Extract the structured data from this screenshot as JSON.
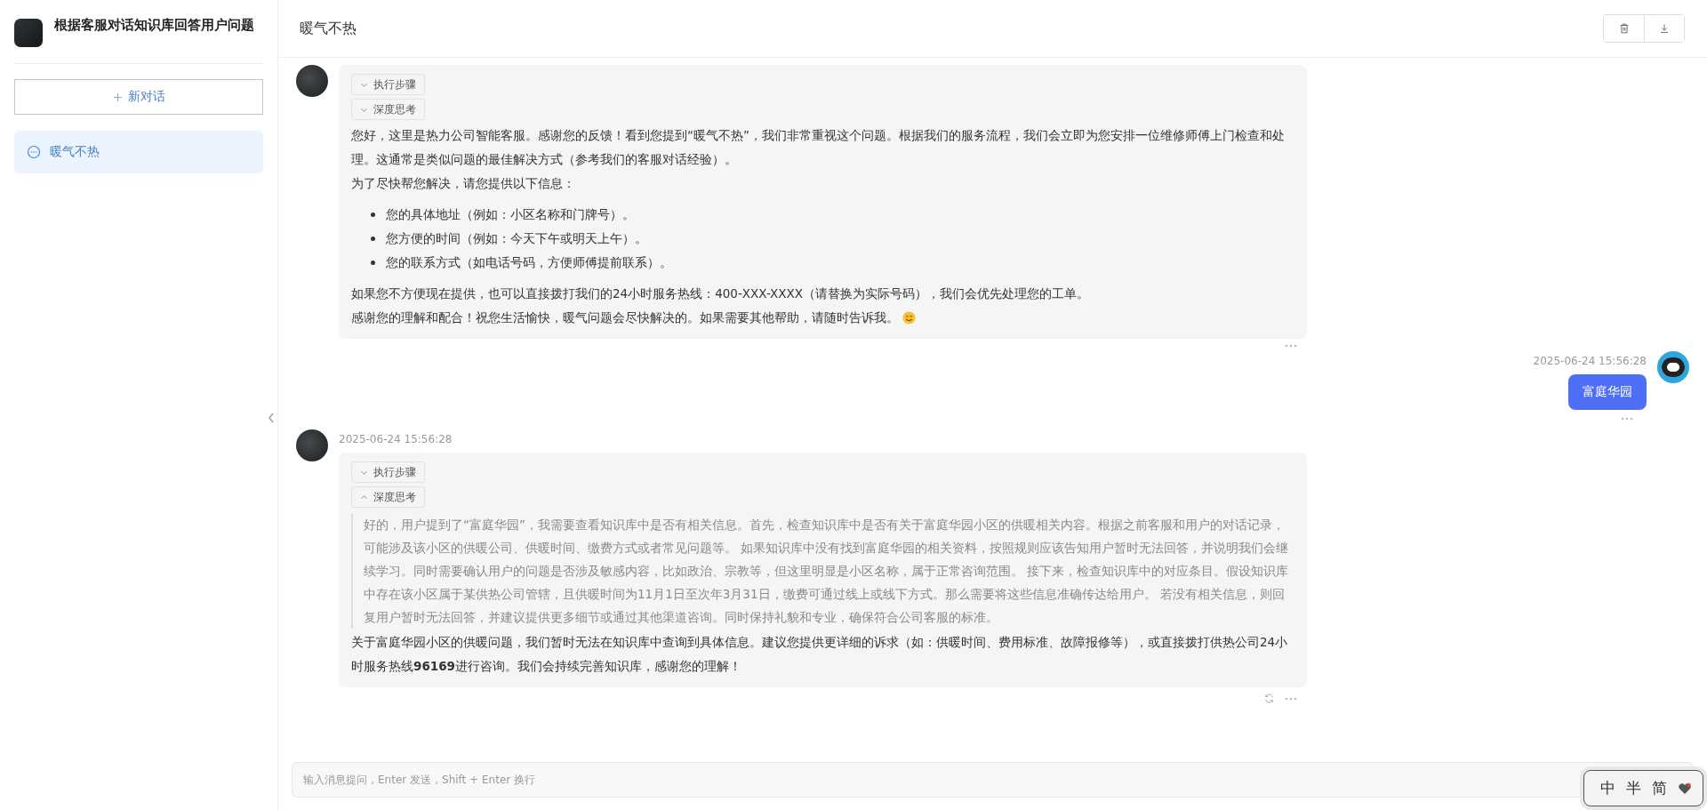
{
  "app": {
    "title": "根据客服对话知识库回答用户问题"
  },
  "new_chat_button": {
    "label": "新对话"
  },
  "conversations": [
    {
      "title": "暖气不热",
      "selected": true
    }
  ],
  "chat": {
    "title": "暖气不热"
  },
  "messages": [
    {
      "kind": "assistant",
      "steps": [
        {
          "label": "执行步骤",
          "expanded": false
        },
        {
          "label": "深度思考",
          "expanded": false
        }
      ],
      "blocks": [
        {
          "kind": "text",
          "lines": [
            "您好，这里是热力公司智能客服。感谢您的反馈！看到您提到“暖气不热”，我们非常重视这个问题。根据我们的服务流程，我们会立即为您安排一位维修师傅上门检查和处理。这通常是类似问题的最佳解决方式（参考我们的客服对话经验）。",
            "为了尽快帮您解决，请您提供以下信息："
          ]
        },
        {
          "kind": "list",
          "items": [
            "您的具体地址（例如：小区名称和门牌号）。",
            "您方便的时间（例如：今天下午或明天上午）。",
            "您的联系方式（如电话号码，方便师傅提前联系）。"
          ]
        },
        {
          "kind": "text_with_emoji",
          "lines": [
            "如果您不方便现在提供，也可以直接拨打我们的24小时服务热线：400-XXX-XXXX（请替换为实际号码），我们会优先处理您的工单。",
            "感谢您的理解和配合！祝您生活愉快，暖气问题会尽快解决的。如果需要其他帮助，请随时告诉我。"
          ]
        }
      ],
      "regenerate": false
    },
    {
      "kind": "user",
      "time": "2025-06-24 15:56:28",
      "text": "富庭华园"
    },
    {
      "kind": "assistant",
      "time": "2025-06-24 15:56:28",
      "steps": [
        {
          "label": "执行步骤",
          "expanded": false
        },
        {
          "label": "深度思考",
          "expanded": true
        }
      ],
      "blocks": [
        {
          "kind": "thinking",
          "text": "好的，用户提到了“富庭华园”，我需要查看知识库中是否有相关信息。首先，检查知识库中是否有关于富庭华园小区的供暖相关内容。根据之前客服和用户的对话记录，可能涉及该小区的供暖公司、供暖时间、缴费方式或者常见问题等。 如果知识库中没有找到富庭华园的相关资料，按照规则应该告知用户暂时无法回答，并说明我们会继续学习。同时需要确认用户的问题是否涉及敏感内容，比如政治、宗教等，但这里明显是小区名称，属于正常咨询范围。 接下来，检查知识库中的对应条目。假设知识库中存在该小区属于某供热公司管辖，且供暖时间为11月1日至次年3月31日，缴费可通过线上或线下方式。那么需要将这些信息准确传达给用户。 若没有相关信息，则回复用户暂时无法回答，并建议提供更多细节或通过其他渠道咨询。同时保持礼貌和专业，确保符合公司客服的标准。"
        },
        {
          "kind": "text",
          "lines": [
            "关于富庭华园小区的供暖问题，我们暂时无法在知识库中查询到具体信息。建议您提供更详细的诉求（如：供暖时间、费用标准、故障报修等），或直接拨打供热公司24小时服务热线**96169**进行咨询。我们会持续完善知识库，感谢您的理解！"
          ]
        }
      ],
      "regenerate": true
    }
  ],
  "input": {
    "placeholder": "输入消息提问，Enter 发送，Shift + Enter 换行"
  },
  "ime_toolbar": {
    "items": [
      "中",
      "半",
      "简"
    ]
  }
}
